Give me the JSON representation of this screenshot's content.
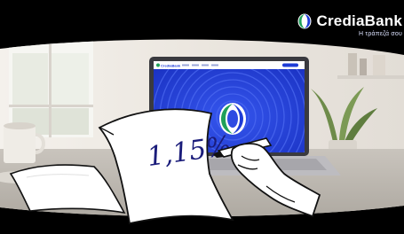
{
  "brand": {
    "name": "CrediaBank",
    "tagline": "Η τράπεζά σου",
    "logo_icon": "crediabank-logo-icon",
    "colors": {
      "brand_green": "#1fa05a",
      "brand_blue": "#1e3cd6",
      "laptop_screen": "#2340d8"
    }
  },
  "note": {
    "rate": "1,15%"
  },
  "laptop": {
    "nav_brand": "CrediaBank"
  }
}
